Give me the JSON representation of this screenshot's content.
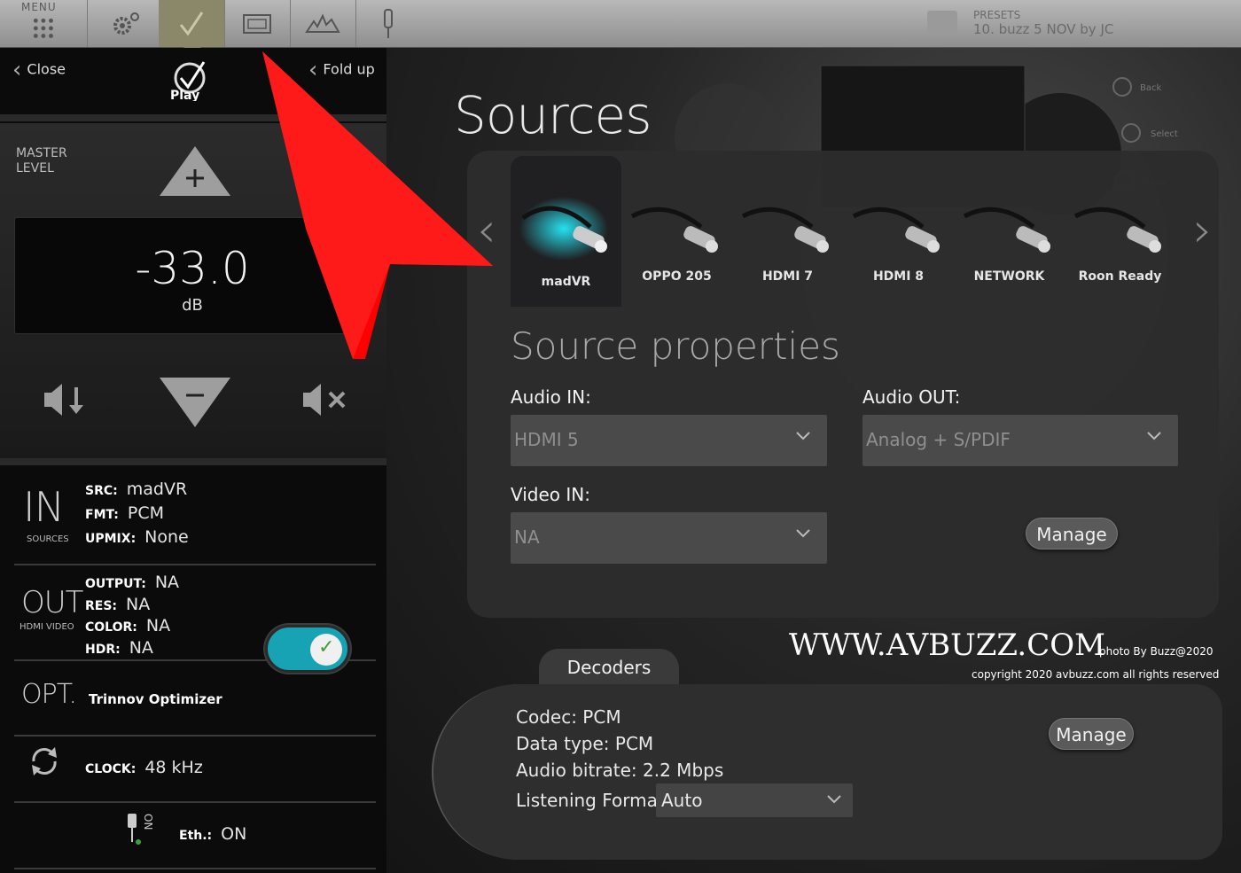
{
  "topbar": {
    "menu_label": "MENU",
    "presets_label": "PRESETS",
    "presets_value": "10. buzz 5 NOV by JC",
    "buttons": [
      "gear-icon",
      "check-icon",
      "display-icon",
      "waveform-icon",
      "plug-icon"
    ]
  },
  "left": {
    "close_label": "Close",
    "fold_label": "Fold up",
    "logo_text": "Play",
    "master": {
      "label": "MASTER LEVEL",
      "value": "-33.0",
      "unit": "dB"
    },
    "in": {
      "big": "IN",
      "sub": "SOURCES",
      "rows": [
        {
          "k": "SRC:",
          "v": "madVR"
        },
        {
          "k": "FMT:",
          "v": "PCM"
        },
        {
          "k": "UPMIX:",
          "v": "None"
        }
      ]
    },
    "out": {
      "big": "OUT",
      "sub": "HDMI VIDEO",
      "rows": [
        {
          "k": "OUTPUT:",
          "v": "NA"
        },
        {
          "k": "RES:",
          "v": "NA"
        },
        {
          "k": "COLOR:",
          "v": "NA"
        },
        {
          "k": "HDR:",
          "v": "NA"
        }
      ]
    },
    "opt": {
      "big": "OPT.",
      "label": "Trinnov Optimizer",
      "enabled": true
    },
    "clock": {
      "k": "CLOCK:",
      "v": "48 kHz"
    },
    "eth": {
      "vertical": "ON",
      "k": "Eth.:",
      "v": "ON"
    }
  },
  "main": {
    "title": "Sources",
    "sources": [
      "madVR",
      "OPPO 205",
      "HDMI 7",
      "HDMI 8",
      "NETWORK",
      "Roon Ready"
    ],
    "selected_source": "madVR",
    "props_title": "Source properties",
    "audio_in_label": "Audio IN:",
    "audio_in_value": "HDMI 5",
    "audio_out_label": "Audio OUT:",
    "audio_out_value": "Analog + S/PDIF",
    "video_in_label": "Video IN:",
    "video_in_value": "NA",
    "manage_label": "Manage"
  },
  "decoders": {
    "tab": "Decoders",
    "codec": "Codec: PCM",
    "data_type": "Data type: PCM",
    "bitrate": "Audio bitrate: 2.2 Mbps",
    "format_label": "Listening Format:",
    "format_value": "Auto",
    "manage_label": "Manage"
  },
  "watermark": {
    "site": "WWW.AVBUZZ.COM",
    "photo_by": "photo By Buzz@2020",
    "copyright": "copyright 2020 avbuzz.com all rights reserved"
  },
  "colors": {
    "accent": "#17a3b3",
    "check": "#3aa236",
    "arrow": "#ff0000"
  }
}
